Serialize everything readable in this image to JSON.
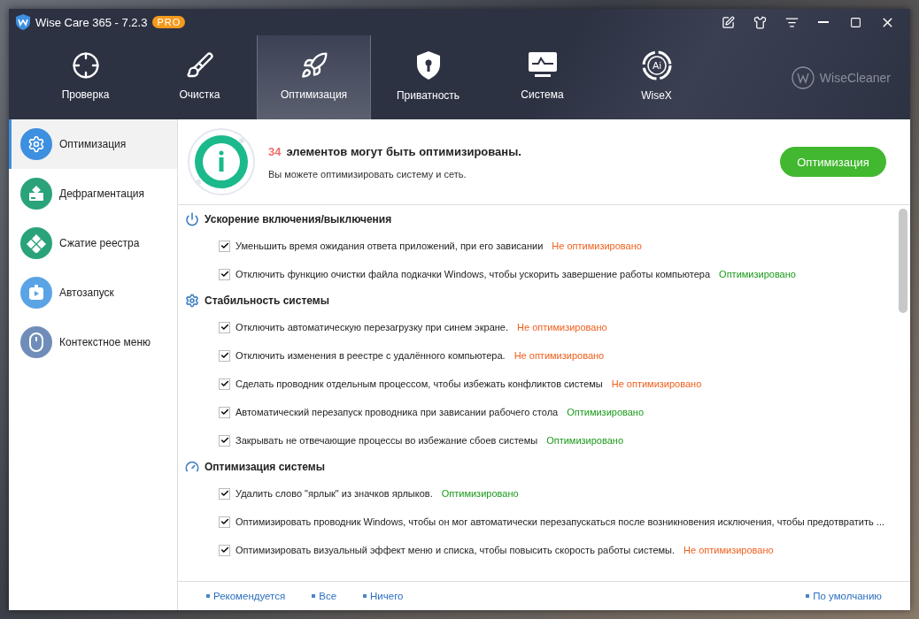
{
  "window": {
    "title": "Wise Care 365 - 7.2.3",
    "badge": "PRO"
  },
  "nav_tabs": [
    {
      "label": "Проверка",
      "kind": "target",
      "selected": false
    },
    {
      "label": "Очистка",
      "kind": "broom",
      "selected": false
    },
    {
      "label": "Оптимизация",
      "kind": "rocket",
      "selected": true
    },
    {
      "label": "Приватность",
      "kind": "shield",
      "selected": false
    },
    {
      "label": "Система",
      "kind": "monitor",
      "selected": false
    },
    {
      "label": "WiseX",
      "kind": "ai",
      "icon_text": "Ai",
      "selected": false
    }
  ],
  "brand": "WiseCleaner",
  "sidebar": {
    "items": [
      {
        "label": "Оптимизация",
        "kind": "gear",
        "color": "#3d8fe0",
        "selected": true
      },
      {
        "label": "Дефрагментация",
        "kind": "disk",
        "color": "#2aa37a",
        "selected": false
      },
      {
        "label": "Сжатие реестра",
        "kind": "registry",
        "color": "#2aa37a",
        "selected": false
      },
      {
        "label": "Автозапуск",
        "kind": "play",
        "color": "#5aa4e6",
        "selected": false
      },
      {
        "label": "Контекстное меню",
        "kind": "mouse",
        "color": "#6f8db8",
        "selected": false
      }
    ]
  },
  "summary": {
    "count": "34",
    "headline": "элементов могут быть оптимизированы.",
    "subtitle": "Вы можете оптимизировать систему и сеть.",
    "button": "Оптимизация"
  },
  "sections": [
    {
      "title": "Ускорение включения/выключения",
      "kind": "power",
      "items": [
        {
          "label": "Уменьшить время ожидания ответа приложений, при его зависании",
          "checked": true,
          "optimized": false,
          "status": "Не оптимизировано"
        },
        {
          "label": "Отключить функцию очистки файла подкачки Windows, чтобы ускорить завершение работы компьютера",
          "checked": true,
          "optimized": true,
          "status": "Оптимизировано"
        }
      ]
    },
    {
      "title": "Стабильность системы",
      "kind": "gear",
      "items": [
        {
          "label": "Отключить автоматическую перезагрузку при синем экране.",
          "checked": true,
          "optimized": false,
          "status": "Не оптимизировано"
        },
        {
          "label": "Отключить изменения в реестре с удалённого компьютера.",
          "checked": true,
          "optimized": false,
          "status": "Не оптимизировано"
        },
        {
          "label": "Сделать проводник отдельным процессом, чтобы избежать конфликтов системы",
          "checked": true,
          "optimized": false,
          "status": "Не оптимизировано"
        },
        {
          "label": "Автоматический перезапуск проводника при зависании рабочего стола",
          "checked": true,
          "optimized": true,
          "status": "Оптимизировано"
        },
        {
          "label": "Закрывать не отвечающие процессы во избежание сбоев системы",
          "checked": true,
          "optimized": true,
          "status": "Оптимизировано"
        }
      ]
    },
    {
      "title": "Оптимизация системы",
      "kind": "gauge",
      "items": [
        {
          "label": "Удалить слово \"ярлык\" из значков ярлыков.",
          "checked": true,
          "optimized": true,
          "status": "Оптимизировано"
        },
        {
          "label": "Оптимизировать проводник Windows, чтобы он мог автоматически перезапускаться после возникновения исключения, чтобы предотвратить ...",
          "checked": true
        },
        {
          "label": "Оптимизировать визуальный эффект меню и списка, чтобы повысить скорость работы системы.",
          "checked": true,
          "optimized": false,
          "status": "Не оптимизировано"
        }
      ]
    }
  ],
  "footer": {
    "left_links": [
      "Рекомендуется",
      "Все",
      "Ничего"
    ],
    "right_link": "По умолчанию"
  }
}
